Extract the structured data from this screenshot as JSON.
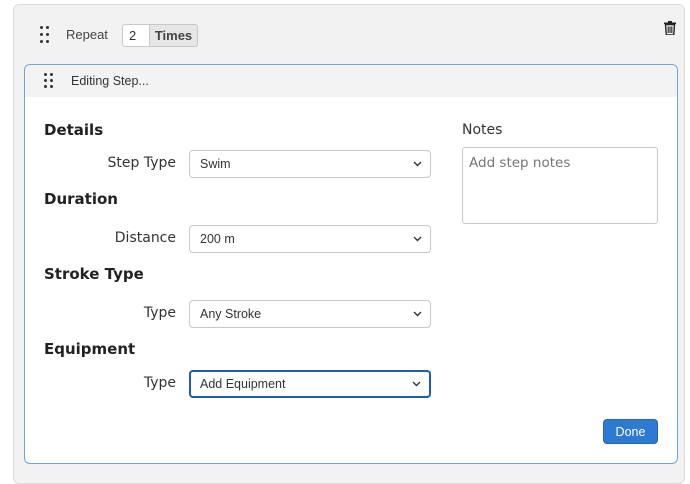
{
  "repeat": {
    "label": "Repeat",
    "count": "2",
    "times_label": "Times"
  },
  "icons": {
    "drag_handle": "drag-handle-icon",
    "trash": "trash-icon",
    "chevron": "chevron-down-icon"
  },
  "card": {
    "title": "Editing Step..."
  },
  "details": {
    "heading": "Details",
    "step_type_label": "Step Type",
    "step_type_value": "Swim"
  },
  "duration": {
    "heading": "Duration",
    "distance_label": "Distance",
    "distance_value": "200 m"
  },
  "stroke_type": {
    "heading": "Stroke Type",
    "type_label": "Type",
    "type_value": "Any Stroke"
  },
  "equipment": {
    "heading": "Equipment",
    "type_label": "Type",
    "type_value": "Add Equipment"
  },
  "notes": {
    "label": "Notes",
    "placeholder": "Add step notes"
  },
  "actions": {
    "done_label": "Done"
  },
  "colors": {
    "accent": "#2f7ad1",
    "card_border": "#6ea6d8",
    "focus_border": "#1f5fa8"
  }
}
